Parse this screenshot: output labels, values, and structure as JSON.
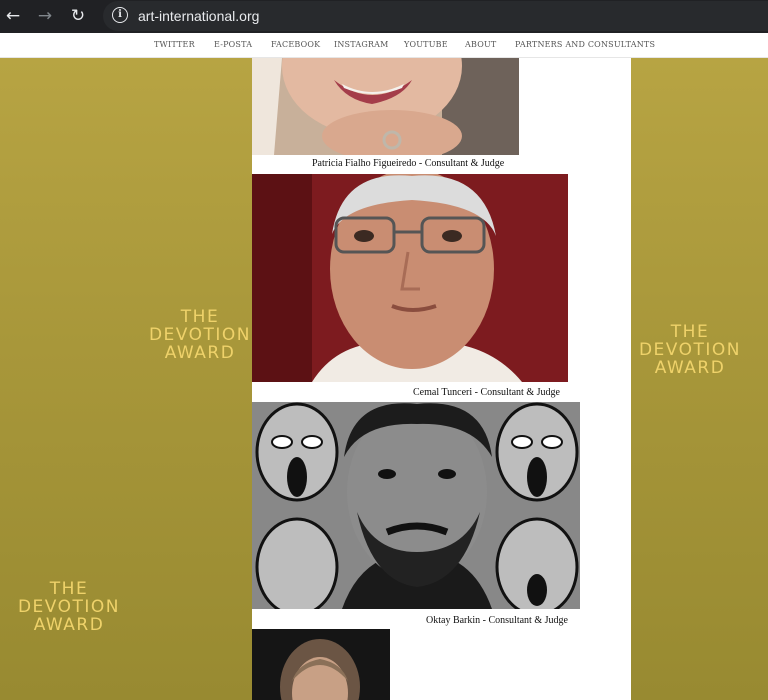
{
  "browser": {
    "url": "art-international.org"
  },
  "nav": {
    "items": [
      "TWITTER",
      "E-POSTA",
      "FACEBOOK",
      "INSTAGRAM",
      "YOUTUBE",
      "ABOUT",
      "PARTNERS AND CONSULTANTS"
    ]
  },
  "background": {
    "award_line1": "THE",
    "award_line2": "DEVOTION",
    "award_line3": "AWARD"
  },
  "people": [
    {
      "caption": "Patricia Fialho Figueiredo - Consultant & Judge"
    },
    {
      "caption": "Cemal Tunceri - Consultant & Judge"
    },
    {
      "caption": "Oktay Barkin - Consultant & Judge"
    }
  ],
  "colors": {
    "chrome": "#202124",
    "gold": "#a8973a",
    "award_text": "#efd26a"
  }
}
